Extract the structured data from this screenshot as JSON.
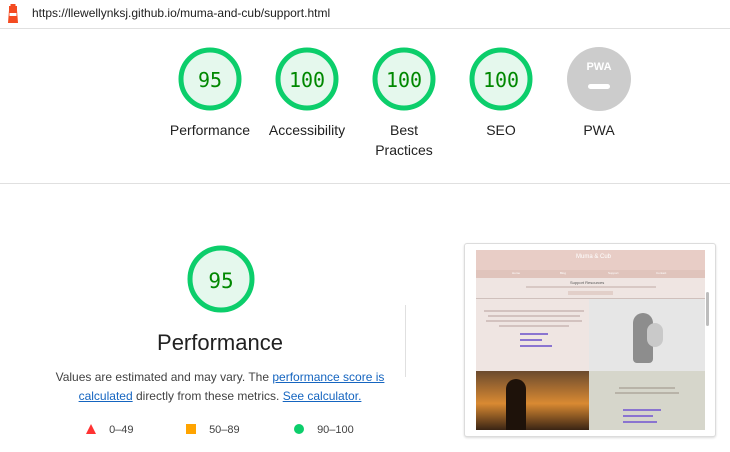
{
  "url": "https://llewellynksj.github.io/muma-and-cub/support.html",
  "colors": {
    "pass": "#0cce6b",
    "pass_text": "#008800",
    "pass_fill": "#e5f8ed",
    "na": "#cccccc",
    "link": "#1565c0"
  },
  "gauges": [
    {
      "score": "95",
      "label": "Performance"
    },
    {
      "score": "100",
      "label": "Accessibility"
    },
    {
      "score": "100",
      "label": "Best Practices"
    },
    {
      "score": "100",
      "label": "SEO"
    },
    {
      "score": "",
      "label": "PWA",
      "badge": "PWA"
    }
  ],
  "performance": {
    "score": "95",
    "title": "Performance",
    "desc_prefix": "Values are estimated and may vary. The ",
    "link1": "performance score is calculated",
    "desc_middle": " directly from these metrics. ",
    "link2": "See calculator."
  },
  "legend": [
    {
      "icon": "triangle",
      "label": "0–49"
    },
    {
      "icon": "square",
      "label": "50–89"
    },
    {
      "icon": "circle",
      "label": "90–100"
    }
  ],
  "thumbnail": {
    "site_title": "Muma & Cub",
    "nav": [
      "Home",
      "Blog",
      "Support",
      "Contact"
    ],
    "section_title": "Support Resources"
  }
}
